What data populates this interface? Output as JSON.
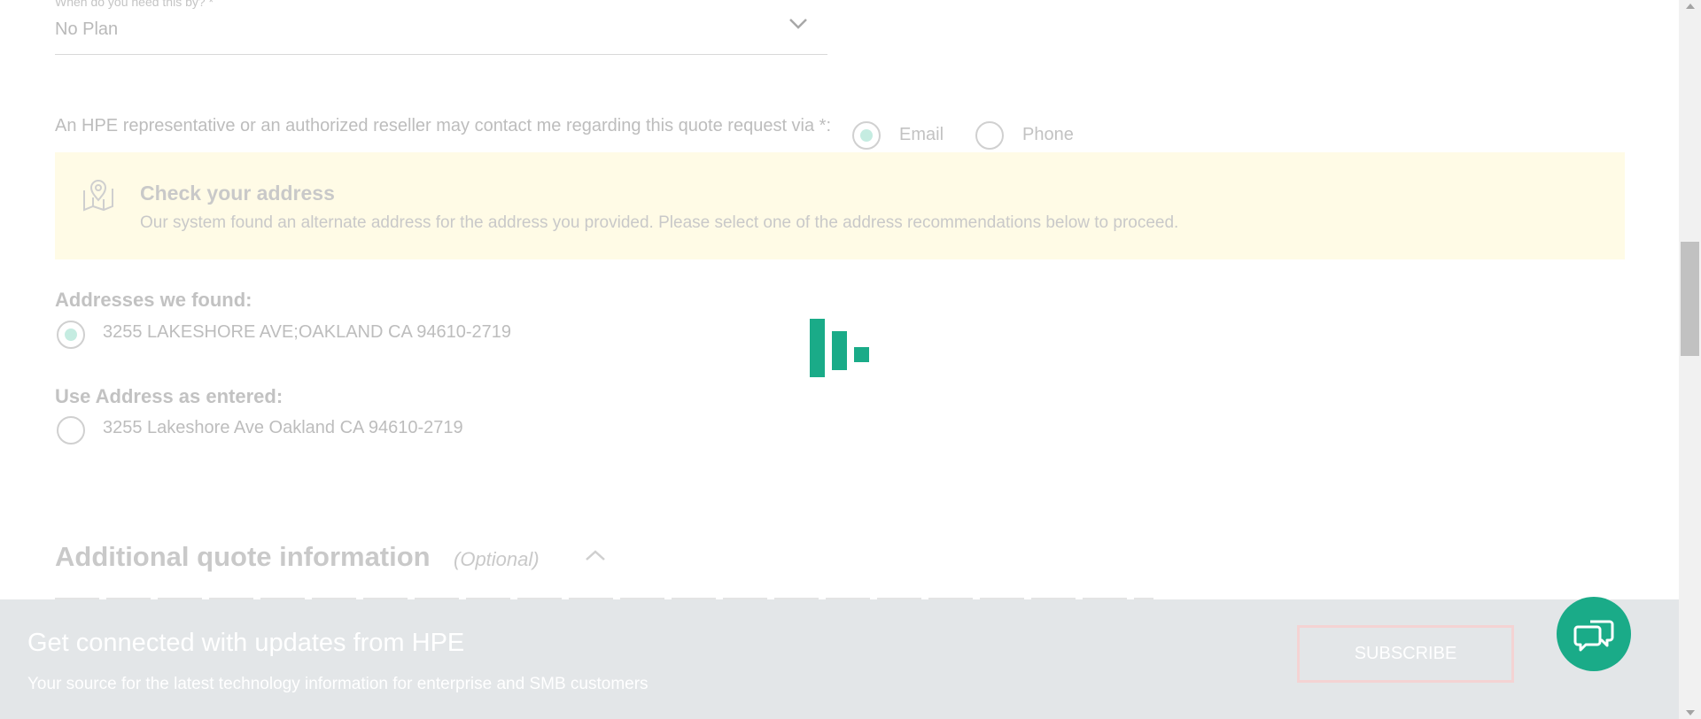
{
  "form": {
    "needby_label": "When do you need this by? *",
    "needby_value": "No Plan",
    "contact_text": "An HPE representative or an authorized reseller may contact me regarding this quote request via *:",
    "contact_options": [
      {
        "label": "Email",
        "selected": true
      },
      {
        "label": "Phone",
        "selected": false
      }
    ]
  },
  "alert": {
    "icon": "map-pin-icon",
    "title": "Check your address",
    "message": "Our system found an alternate address for the address you provided. Please select one of the address recommendations below to proceed."
  },
  "addresses_found": {
    "heading": "Addresses we found:",
    "option": "3255 LAKESHORE AVE;OAKLAND CA 94610-2719"
  },
  "address_entered": {
    "heading": "Use Address as entered:",
    "option": "3255 Lakeshore Ave Oakland CA 94610-2719"
  },
  "additional_info": {
    "title": "Additional quote information",
    "optional_label": "(Optional)"
  },
  "subscribe_banner": {
    "title": "Get connected with updates from HPE",
    "subtitle": "Your source for the latest technology information for enterprise and SMB customers",
    "button_label": "SUBSCRIBE"
  },
  "chat": {
    "icon": "chat-bubbles-icon"
  },
  "loader": {
    "icon": "loading-spinner-icon"
  },
  "colors": {
    "accent": "#1aab88",
    "alert_background": "#fffbe6",
    "banner_background": "#e3e6e8"
  }
}
